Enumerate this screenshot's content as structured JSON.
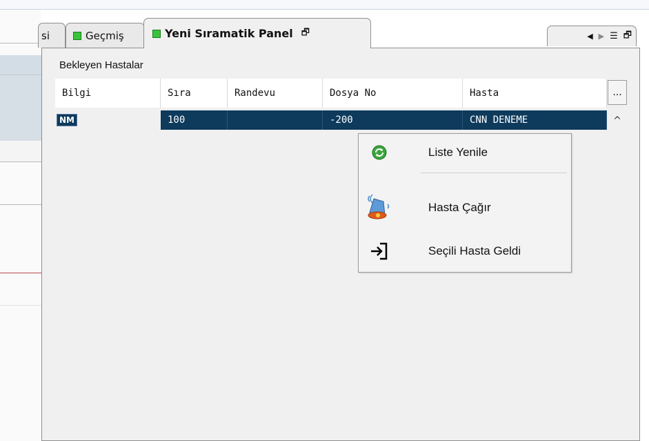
{
  "tabs": {
    "partial_label": "si",
    "gecmis_label": "Geçmiş",
    "active_label": "Yeni Sıramatik Panel",
    "active_restore_glyph": "🗗"
  },
  "tab_nav": {
    "prev_glyph": "◀",
    "next_glyph": "▶",
    "menu_glyph": "☰",
    "restore_glyph": "🗗"
  },
  "group": {
    "title": "Bekleyen Hastalar"
  },
  "grid": {
    "columns": [
      "Bilgi",
      "Sıra",
      "Randevu",
      "Dosya No",
      "Hasta"
    ],
    "more_button": "...",
    "scroll_up": "^",
    "rows": [
      {
        "bilgi_badge": "NM",
        "sira": "100",
        "randevu": "",
        "dosya_no": "-200",
        "hasta": "CNN DENEME"
      }
    ]
  },
  "context_menu": {
    "items": [
      {
        "label": "Liste Yenile",
        "icon": "refresh-icon"
      },
      {
        "label": "Hasta Çağır",
        "icon": "bell-icon"
      },
      {
        "label": "Seçili Hasta Geldi",
        "icon": "sign-in-icon"
      }
    ]
  },
  "colors": {
    "selected_row": "#0e3a5c",
    "tab_square": "#39c43c",
    "panel_bg": "#f0f0f0"
  }
}
